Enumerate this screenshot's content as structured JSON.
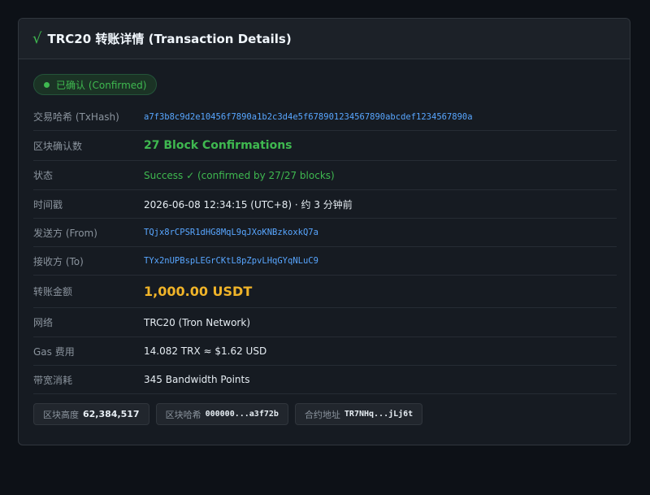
{
  "header": {
    "icon": "check-icon",
    "check_glyph": "√",
    "title": "TRC20 转账详情 (Transaction Details)"
  },
  "status": {
    "label": "已确认 (Confirmed)",
    "color": "#3fb950"
  },
  "rows": [
    {
      "label": "交易哈希 (TxHash)",
      "value": "a7f3b8c9d2e10456f7890a1b2c3d4e5f678901234567890abcdef1234567890a"
    },
    {
      "label": "区块确认数",
      "value": "27 Block Confirmations"
    },
    {
      "label": "状态",
      "value": "Success ✓ (confirmed by 27/27 blocks)"
    },
    {
      "label": "时间戳",
      "value": "2026-06-08 12:34:15 (UTC+8) · 约 3 分钟前"
    },
    {
      "label": "发送方 (From)",
      "value": "TQjx8rCPSR1dHG8MqL9qJXoKNBzkoxkQ7a"
    },
    {
      "label": "接收方 (To)",
      "value": "TYx2nUPBspLEGrCKtL8pZpvLHqGYqNLuC9"
    },
    {
      "label": "转账金额",
      "value": "1,000.00 USDT"
    },
    {
      "label": "网络",
      "value": "TRC20 (Tron Network)"
    },
    {
      "label": "Gas 费用",
      "value": "14.082 TRX ≈ $1.62 USD"
    },
    {
      "label": "带宽消耗",
      "value": "345 Bandwidth Points"
    }
  ],
  "chips": [
    {
      "label": "区块高度",
      "value": "62,384,517"
    },
    {
      "label": "区块哈希",
      "value": "000000...a3f72b"
    },
    {
      "label": "合约地址",
      "value": "TR7NHq...jLj6t"
    }
  ]
}
